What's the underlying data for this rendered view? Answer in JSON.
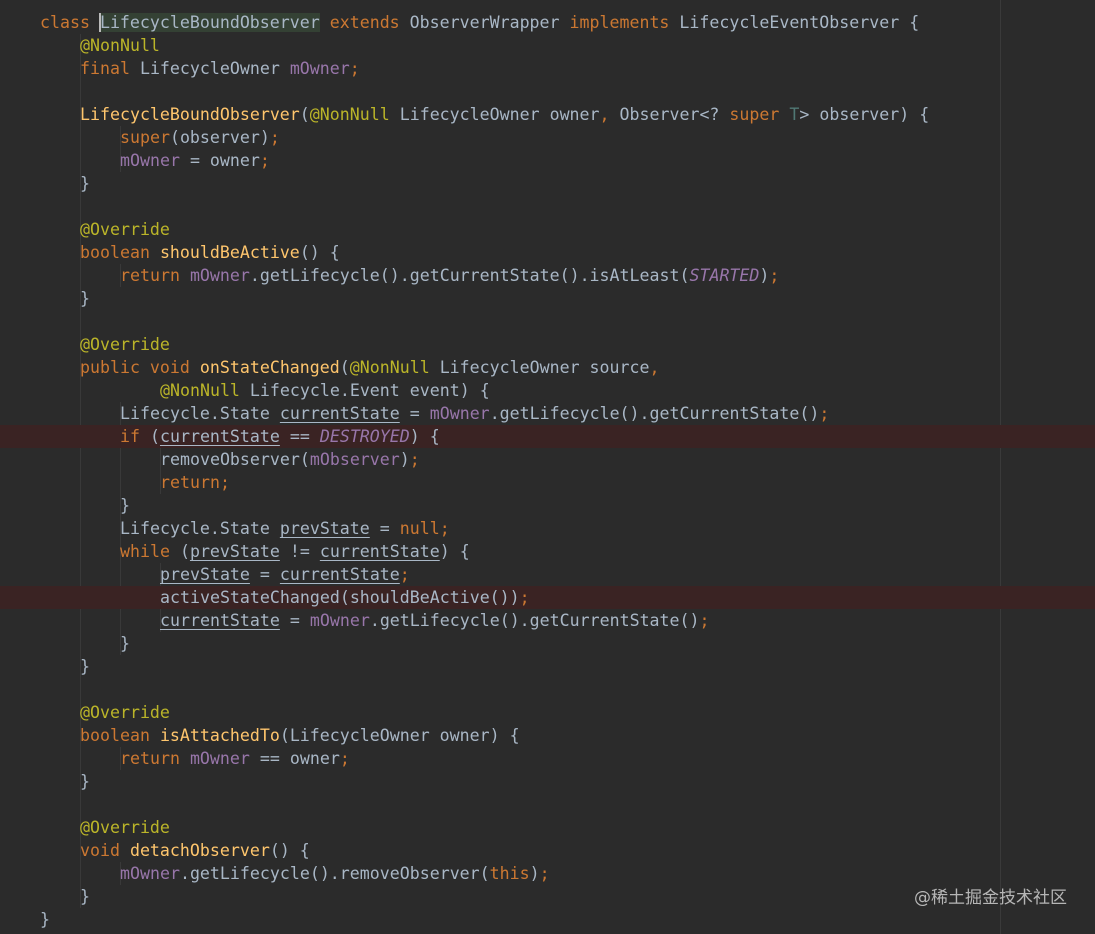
{
  "watermark": "@稀土掘金技术社区",
  "colors": {
    "background": "#2b2b2b",
    "keyword": "#cc7832",
    "method": "#ffc66d",
    "annotation": "#bbb529",
    "field": "#9876aa",
    "plain": "#a9b7c6",
    "breakpoint_line": "#3a2323"
  },
  "code_lines": [
    {
      "indent": 0,
      "tokens": [
        [
          "kw",
          "class "
        ],
        [
          "hlname",
          "LifecycleBoundObserver"
        ],
        [
          "kw",
          " extends "
        ],
        [
          "pl",
          "ObserverWrapper"
        ],
        [
          "kw",
          " implements "
        ],
        [
          "pl",
          "LifecycleEventObserver {"
        ]
      ]
    },
    {
      "indent": 1,
      "tokens": [
        [
          "an",
          "@NonNull"
        ]
      ]
    },
    {
      "indent": 1,
      "tokens": [
        [
          "kw",
          "final "
        ],
        [
          "pl",
          "LifecycleOwner "
        ],
        [
          "fd",
          "mOwner"
        ],
        [
          "kw",
          ";"
        ]
      ]
    },
    {
      "indent": 0,
      "tokens": []
    },
    {
      "indent": 1,
      "tokens": [
        [
          "fn",
          "LifecycleBoundObserver"
        ],
        [
          "pl",
          "("
        ],
        [
          "an",
          "@NonNull"
        ],
        [
          "pl",
          " LifecycleOwner owner"
        ],
        [
          "kw",
          ", "
        ],
        [
          "pl",
          "Observer<? "
        ],
        [
          "kw",
          "super "
        ],
        [
          "tp",
          "T"
        ],
        [
          "pl",
          "> observer) {"
        ]
      ]
    },
    {
      "indent": 2,
      "tokens": [
        [
          "kw",
          "super"
        ],
        [
          "pl",
          "(observer)"
        ],
        [
          "kw",
          ";"
        ]
      ]
    },
    {
      "indent": 2,
      "tokens": [
        [
          "fd",
          "mOwner"
        ],
        [
          "pl",
          " = owner"
        ],
        [
          "kw",
          ";"
        ]
      ]
    },
    {
      "indent": 1,
      "tokens": [
        [
          "pl",
          "}"
        ]
      ]
    },
    {
      "indent": 0,
      "tokens": []
    },
    {
      "indent": 1,
      "tokens": [
        [
          "an",
          "@Override"
        ]
      ]
    },
    {
      "indent": 1,
      "tokens": [
        [
          "kw",
          "boolean "
        ],
        [
          "fn",
          "shouldBeActive"
        ],
        [
          "pl",
          "() {"
        ]
      ]
    },
    {
      "indent": 2,
      "tokens": [
        [
          "kw",
          "return "
        ],
        [
          "fd",
          "mOwner"
        ],
        [
          "pl",
          ".getLifecycle().getCurrentState().isAtLeast("
        ],
        [
          "st",
          "STARTED"
        ],
        [
          "pl",
          ")"
        ],
        [
          "kw",
          ";"
        ]
      ]
    },
    {
      "indent": 1,
      "tokens": [
        [
          "pl",
          "}"
        ]
      ]
    },
    {
      "indent": 0,
      "tokens": []
    },
    {
      "indent": 1,
      "tokens": [
        [
          "an",
          "@Override"
        ]
      ]
    },
    {
      "indent": 1,
      "tokens": [
        [
          "kw",
          "public void "
        ],
        [
          "fn",
          "onStateChanged"
        ],
        [
          "pl",
          "("
        ],
        [
          "an",
          "@NonNull"
        ],
        [
          "pl",
          " LifecycleOwner source"
        ],
        [
          "kw",
          ","
        ]
      ]
    },
    {
      "indent": 3,
      "tokens": [
        [
          "an",
          "@NonNull"
        ],
        [
          "pl",
          " Lifecycle.Event event) {"
        ]
      ]
    },
    {
      "indent": 2,
      "tokens": [
        [
          "pl",
          "Lifecycle.State "
        ],
        [
          "lv",
          "currentState"
        ],
        [
          "pl",
          " = "
        ],
        [
          "fd",
          "mOwner"
        ],
        [
          "pl",
          ".getLifecycle().getCurrentState()"
        ],
        [
          "kw",
          ";"
        ]
      ]
    },
    {
      "indent": 2,
      "bp": true,
      "tokens": [
        [
          "kw",
          "if "
        ],
        [
          "pl",
          "("
        ],
        [
          "lv",
          "currentState"
        ],
        [
          "pl",
          " == "
        ],
        [
          "st",
          "DESTROYED"
        ],
        [
          "pl",
          ") {"
        ]
      ]
    },
    {
      "indent": 3,
      "tokens": [
        [
          "pl",
          "removeObserver("
        ],
        [
          "fd",
          "mObserver"
        ],
        [
          "pl",
          ")"
        ],
        [
          "kw",
          ";"
        ]
      ]
    },
    {
      "indent": 3,
      "tokens": [
        [
          "kw",
          "return;"
        ]
      ]
    },
    {
      "indent": 2,
      "tokens": [
        [
          "pl",
          "}"
        ]
      ]
    },
    {
      "indent": 2,
      "tokens": [
        [
          "pl",
          "Lifecycle.State "
        ],
        [
          "lv",
          "prevState"
        ],
        [
          "pl",
          " = "
        ],
        [
          "kw",
          "null;"
        ]
      ]
    },
    {
      "indent": 2,
      "tokens": [
        [
          "kw",
          "while "
        ],
        [
          "pl",
          "("
        ],
        [
          "lv",
          "prevState"
        ],
        [
          "pl",
          " != "
        ],
        [
          "lv",
          "currentState"
        ],
        [
          "pl",
          ") {"
        ]
      ]
    },
    {
      "indent": 3,
      "tokens": [
        [
          "lv",
          "prevState"
        ],
        [
          "pl",
          " = "
        ],
        [
          "lv",
          "currentState"
        ],
        [
          "kw",
          ";"
        ]
      ]
    },
    {
      "indent": 3,
      "bp": true,
      "tokens": [
        [
          "pl",
          "activeStateChanged(shouldBeActive())"
        ],
        [
          "kw",
          ";"
        ]
      ]
    },
    {
      "indent": 3,
      "tokens": [
        [
          "lv",
          "currentState"
        ],
        [
          "pl",
          " = "
        ],
        [
          "fd",
          "mOwner"
        ],
        [
          "pl",
          ".getLifecycle().getCurrentState()"
        ],
        [
          "kw",
          ";"
        ]
      ]
    },
    {
      "indent": 2,
      "tokens": [
        [
          "pl",
          "}"
        ]
      ]
    },
    {
      "indent": 1,
      "tokens": [
        [
          "pl",
          "}"
        ]
      ]
    },
    {
      "indent": 0,
      "tokens": []
    },
    {
      "indent": 1,
      "tokens": [
        [
          "an",
          "@Override"
        ]
      ]
    },
    {
      "indent": 1,
      "tokens": [
        [
          "kw",
          "boolean "
        ],
        [
          "fn",
          "isAttachedTo"
        ],
        [
          "pl",
          "(LifecycleOwner owner) {"
        ]
      ]
    },
    {
      "indent": 2,
      "tokens": [
        [
          "kw",
          "return "
        ],
        [
          "fd",
          "mOwner"
        ],
        [
          "pl",
          " == owner"
        ],
        [
          "kw",
          ";"
        ]
      ]
    },
    {
      "indent": 1,
      "tokens": [
        [
          "pl",
          "}"
        ]
      ]
    },
    {
      "indent": 0,
      "tokens": []
    },
    {
      "indent": 1,
      "tokens": [
        [
          "an",
          "@Override"
        ]
      ]
    },
    {
      "indent": 1,
      "tokens": [
        [
          "kw",
          "void "
        ],
        [
          "fn",
          "detachObserver"
        ],
        [
          "pl",
          "() {"
        ]
      ]
    },
    {
      "indent": 2,
      "tokens": [
        [
          "fd",
          "mOwner"
        ],
        [
          "pl",
          ".getLifecycle().removeObserver("
        ],
        [
          "kw",
          "this"
        ],
        [
          "pl",
          ")"
        ],
        [
          "kw",
          ";"
        ]
      ]
    },
    {
      "indent": 1,
      "tokens": [
        [
          "pl",
          "}"
        ]
      ]
    },
    {
      "indent": 0,
      "tokens": [
        [
          "pl",
          "}"
        ]
      ]
    }
  ]
}
